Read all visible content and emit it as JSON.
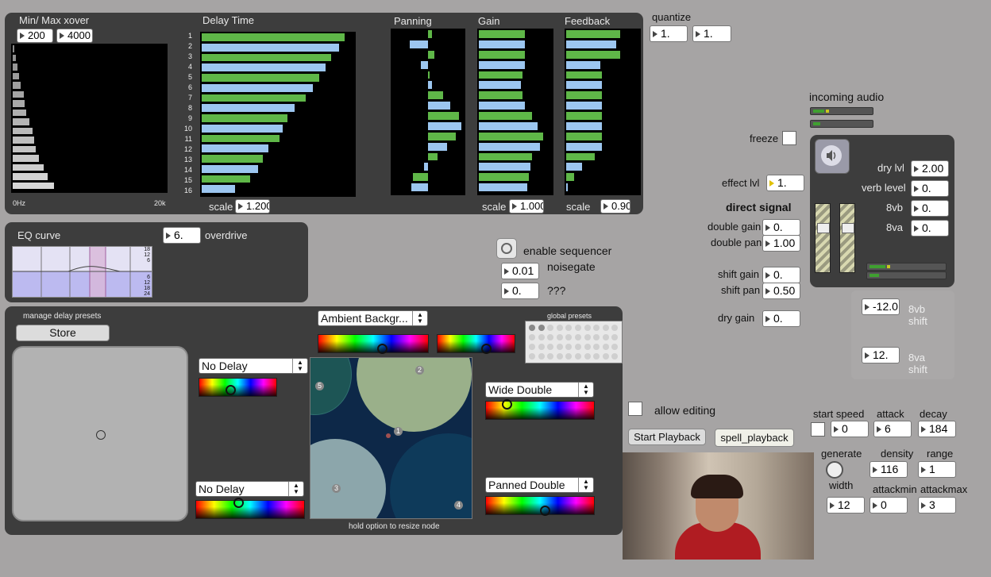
{
  "xover": {
    "title": "Min/ Max xover",
    "min": "200",
    "max": "4000",
    "axis_low": "0Hz",
    "axis_high": "20k",
    "levels": [
      0.01,
      0.02,
      0.03,
      0.04,
      0.05,
      0.07,
      0.08,
      0.09,
      0.11,
      0.13,
      0.14,
      0.15,
      0.17,
      0.2,
      0.23,
      0.27
    ]
  },
  "delay": {
    "title": "Delay Time",
    "scale_label": "scale",
    "scale": "1.200",
    "row_labels": [
      "1",
      "2",
      "3",
      "4",
      "5",
      "6",
      "7",
      "8",
      "9",
      "10",
      "11",
      "12",
      "13",
      "14",
      "15",
      "16"
    ],
    "levels": [
      0.94,
      0.9,
      0.85,
      0.81,
      0.77,
      0.73,
      0.68,
      0.61,
      0.56,
      0.53,
      0.51,
      0.44,
      0.4,
      0.37,
      0.32,
      0.22
    ]
  },
  "panning": {
    "title": "Panning",
    "levels": [
      0.05,
      -0.25,
      0.08,
      -0.1,
      0.02,
      0.05,
      0.2,
      0.3,
      0.42,
      0.45,
      0.37,
      0.25,
      0.13,
      -0.05,
      -0.2,
      -0.22
    ]
  },
  "gain": {
    "title": "Gain",
    "scale_label": "scale",
    "scale": "1.000",
    "levels": [
      0.63,
      0.63,
      0.63,
      0.63,
      0.6,
      0.58,
      0.6,
      0.63,
      0.73,
      0.8,
      0.88,
      0.84,
      0.73,
      0.71,
      0.68,
      0.66
    ]
  },
  "feedback": {
    "title": "Feedback",
    "scale_label": "scale",
    "scale": "0.90",
    "levels": [
      0.74,
      0.68,
      0.74,
      0.47,
      0.49,
      0.49,
      0.49,
      0.49,
      0.49,
      0.49,
      0.49,
      0.49,
      0.39,
      0.22,
      0.11,
      0.02
    ]
  },
  "quantize": {
    "label": "quantize",
    "a": "1.",
    "b": "1."
  },
  "eq": {
    "title": "EQ curve",
    "scale_top": [
      "18",
      "12",
      "6"
    ],
    "scale_bottom": [
      "6",
      "12",
      "18",
      "24"
    ]
  },
  "overdrive": {
    "label": "overdrive",
    "value": "6."
  },
  "sequencer": {
    "enable_label": "enable sequencer",
    "noisegate_label": "noisegate",
    "noisegate": "0.01",
    "unknown_label": "???",
    "unknown": "0."
  },
  "mix": {
    "freeze_label": "freeze",
    "effect_label": "effect lvl",
    "effect": "1.",
    "direct_title": "direct signal",
    "double_gain_label": "double gain",
    "double_gain": "0.",
    "double_pan_label": "double pan",
    "double_pan": "1.00",
    "shift_gain_label": "shift gain",
    "shift_gain": "0.",
    "shift_pan_label": "shift pan",
    "shift_pan": "0.50",
    "dry_gain_label": "dry gain",
    "dry_gain": "0."
  },
  "audio": {
    "incoming_label": "incoming audio",
    "dry_lvl_label": "dry lvl",
    "dry_lvl": "2.00",
    "verb_label": "verb level",
    "verb": "0.",
    "vb8_label": "8vb",
    "vb8": "0.",
    "va8_label": "8va",
    "va8": "0.",
    "vb8_shift": "-12.0",
    "vb8_shift_label": "8vb shift",
    "va8_shift": "12.",
    "va8_shift_label": "8va shift"
  },
  "presets": {
    "manage_label": "manage delay presets",
    "store_label": "Store",
    "menu_top": "Ambient Backgr...",
    "global_label": "global presets",
    "menu_left_top": "No Delay",
    "menu_left_bottom": "No Delay",
    "menu_right_top": "Wide Double",
    "menu_right_bottom": "Panned Double",
    "nodes": [
      "1",
      "2",
      "3",
      "4",
      "5"
    ],
    "hint": "hold option to resize node"
  },
  "playback": {
    "allow_label": "allow editing",
    "start_label": "Start Playback",
    "spell_label": "spell_playback",
    "start_speed_label": "start speed",
    "start_speed": "0",
    "attack_label": "attack",
    "attack": "6",
    "decay_label": "decay",
    "decay": "184",
    "generate_label": "generate",
    "density_label": "density",
    "density": "116",
    "range_label": "range",
    "range": "1",
    "width_label": "width",
    "width": "12",
    "attackmin_label": "attackmin",
    "attackmin": "0",
    "attackmax_label": "attackmax",
    "attackmax": "3"
  }
}
